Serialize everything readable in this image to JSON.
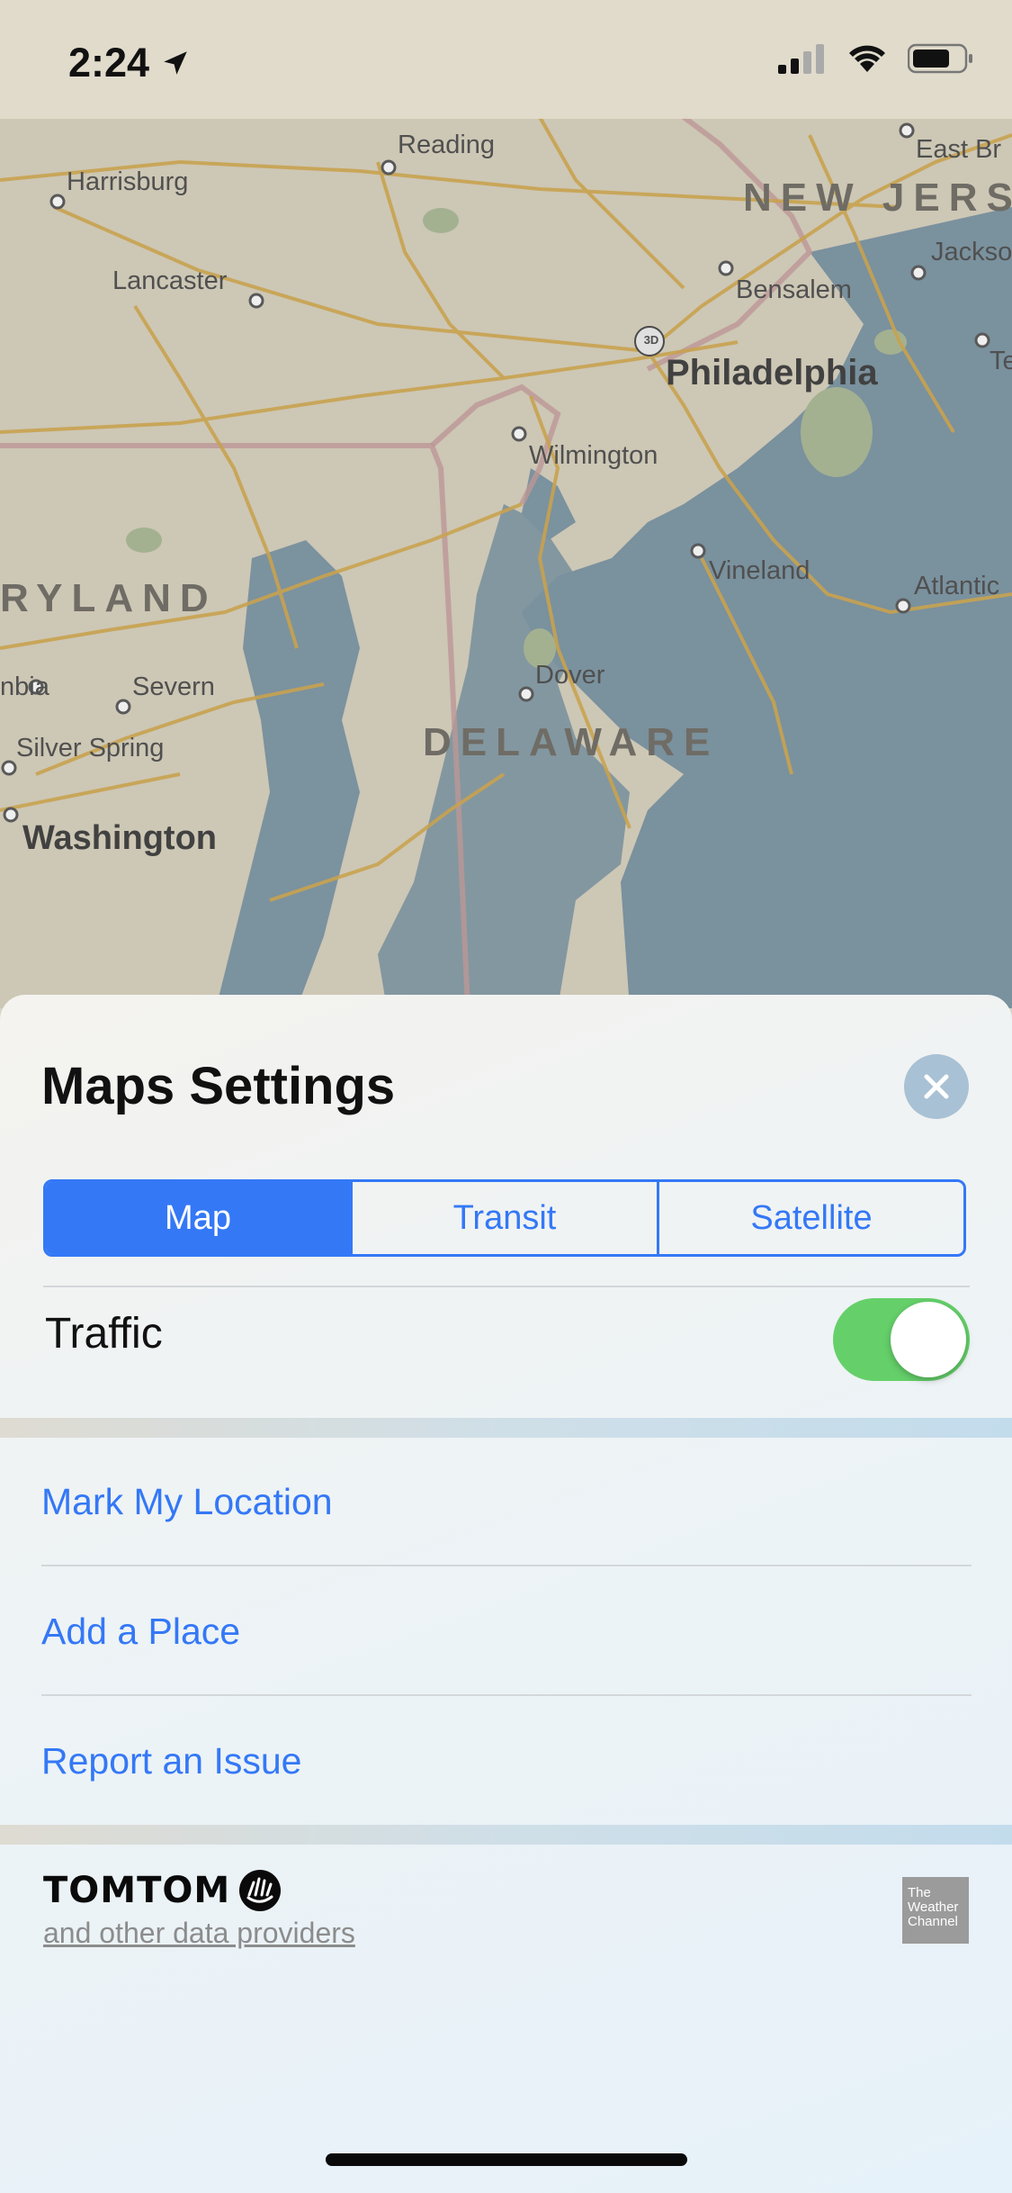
{
  "status_bar": {
    "time": "2:24"
  },
  "map": {
    "cities": {
      "reading": "Reading",
      "east_br": "East Br",
      "harrisburg": "Harrisburg",
      "lancaster": "Lancaster",
      "bensalem": "Bensalem",
      "jackso": "Jackso",
      "philadelphia": "Philadelphia",
      "wilmington": "Wilmington",
      "vineland": "Vineland",
      "atlantic": "Atlantic",
      "severn": "Severn",
      "nbia": "nbia",
      "silver_spring": "Silver Spring",
      "dover": "Dover",
      "washington": "Washington",
      "te": "Te"
    },
    "states": {
      "new_jersey": "NEW JERS",
      "maryland": "RYLAND",
      "delaware": "DELAWARE"
    },
    "badge_3d": "3D"
  },
  "sheet": {
    "title": "Maps Settings",
    "tabs": [
      {
        "label": "Map",
        "active": true
      },
      {
        "label": "Transit",
        "active": false
      },
      {
        "label": "Satellite",
        "active": false
      }
    ],
    "traffic": {
      "label": "Traffic",
      "enabled": true
    },
    "actions": [
      "Mark My Location",
      "Add a Place",
      "Report an Issue"
    ],
    "footer": {
      "tomtom": "TOMTOM",
      "data_providers": "and other data providers",
      "weather_channel": "The Weather Channel"
    }
  },
  "colors": {
    "accent": "#3478f6",
    "toggle_on": "#65d06a"
  }
}
